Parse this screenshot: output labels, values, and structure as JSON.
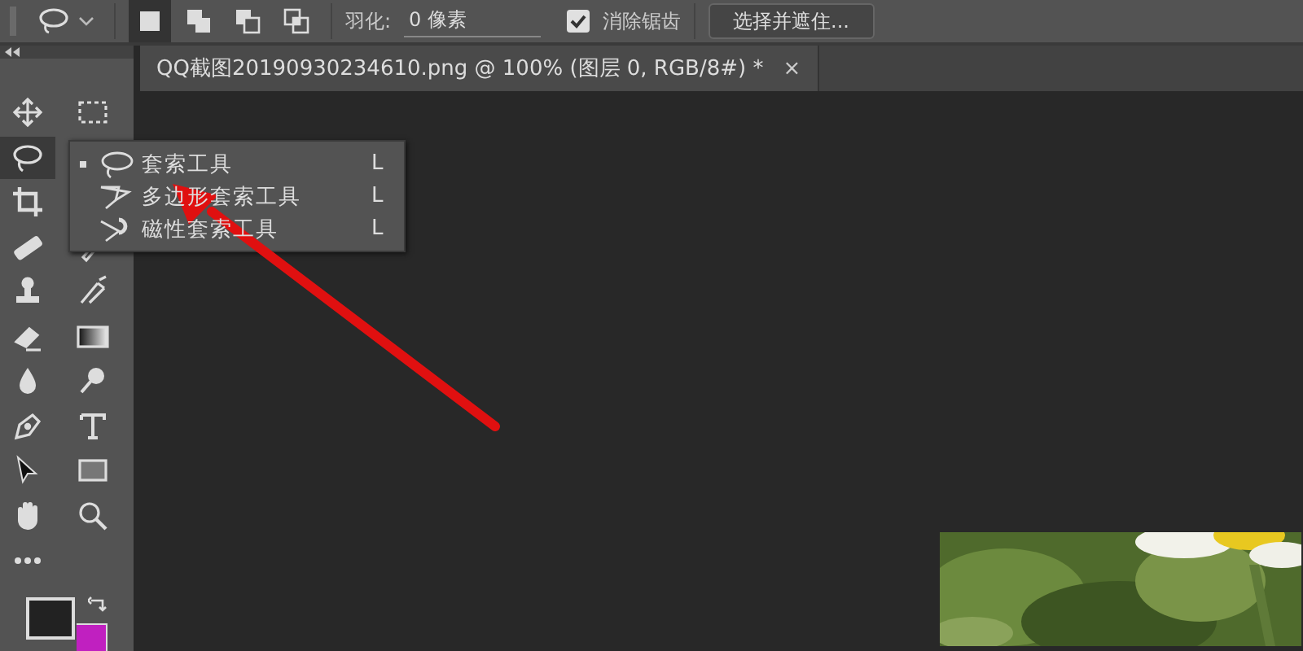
{
  "options_bar": {
    "modes": [
      {
        "selected": true
      },
      {
        "selected": false
      },
      {
        "selected": false
      },
      {
        "selected": false
      }
    ],
    "feather": {
      "label": "羽化:",
      "value": "0 像素"
    },
    "anti_alias": {
      "label": "消除锯齿",
      "checked": true
    },
    "button": "选择并遮住..."
  },
  "tools": [
    {
      "selected": false
    },
    {
      "selected": false
    },
    {
      "selected": true
    },
    {
      "selected": false
    },
    {
      "selected": false
    },
    {
      "selected": false
    },
    {
      "selected": false
    },
    {
      "selected": false
    },
    {
      "selected": false
    },
    {
      "selected": false
    },
    {
      "selected": false
    },
    {
      "selected": false
    },
    {
      "selected": false
    },
    {
      "selected": false
    },
    {
      "selected": false
    },
    {
      "selected": false
    },
    {
      "selected": false
    },
    {
      "selected": false
    },
    {
      "selected": false
    }
  ],
  "document_tab": {
    "title": "QQ截图20190930234610.png @ 100% (图层 0, RGB/8#) *",
    "close": "×"
  },
  "flyout": [
    {
      "label": "套索工具",
      "shortcut": "L",
      "selected": true
    },
    {
      "label": "多边形套索工具",
      "shortcut": "L",
      "selected": false
    },
    {
      "label": "磁性套索工具",
      "shortcut": "L",
      "selected": false
    }
  ]
}
